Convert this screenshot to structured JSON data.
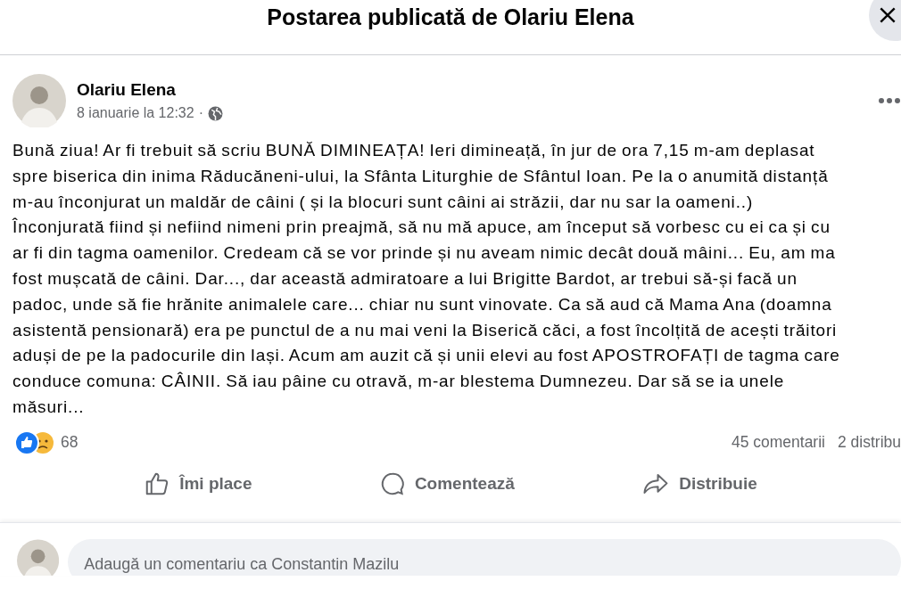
{
  "dialog": {
    "title": "Postarea publicată de Olariu Elena"
  },
  "post": {
    "author": "Olariu Elena",
    "time": "8 ianuarie la 12:32",
    "separator": "·",
    "lines": [
      "Bună ziua! Ar fi trebuit să scriu BUNĂ DIMINEAȚA! Ieri dimineață, în jur de ora 7,15 m-am deplasat",
      "spre biserica din  inima Răducăneni-ului, la  Sfânta Liturghie de Sfântul Ioan. Pe la o anumită distanță",
      "m-au înconjurat  un maldăr de câini ( și la blocuri sunt câini ai străzii, dar nu sar la oameni..)",
      "Înconjurată fiind și nefiind nimeni prin preajmă, să nu mă apuce, am început să vorbesc cu ei ca și cu",
      "ar fi din tagma oamenilor. Credeam că se vor prinde și nu aveam nimic decât două mâini... Eu, am ma",
      "fost mușcată de câini. Dar..., dar această admiratoare a lui Brigitte Bardot, ar trebui să-și facă  un",
      "padoc, unde să fie hrănite animalele care... chiar nu sunt vinovate. Ca să aud că Mama Ana (doamna",
      "asistentă pensionară) era pe punctul de a nu mai veni la Biserică căci, a fost încolțită de acești trăitori",
      "aduși de pe la padocurile din Iași. Acum am auzit că și unii elevi au fost APOSTROFAȚI de tagma care",
      "conduce comuna: CÂINII. Să iau pâine cu otravă, m-ar blestema Dumnezeu. Dar să se ia unele",
      "măsuri..."
    ],
    "reactions_count": "68",
    "comments_count": "45 comentarii",
    "shares_count": "2 distribu",
    "actions": [
      {
        "kind": "like",
        "label": "Îmi place"
      },
      {
        "kind": "comment",
        "label": "Comentează"
      },
      {
        "kind": "share",
        "label": "Distribuie"
      }
    ]
  },
  "composer": {
    "placeholder": "Adaugă un comentariu ca Constantin Mazilu"
  }
}
